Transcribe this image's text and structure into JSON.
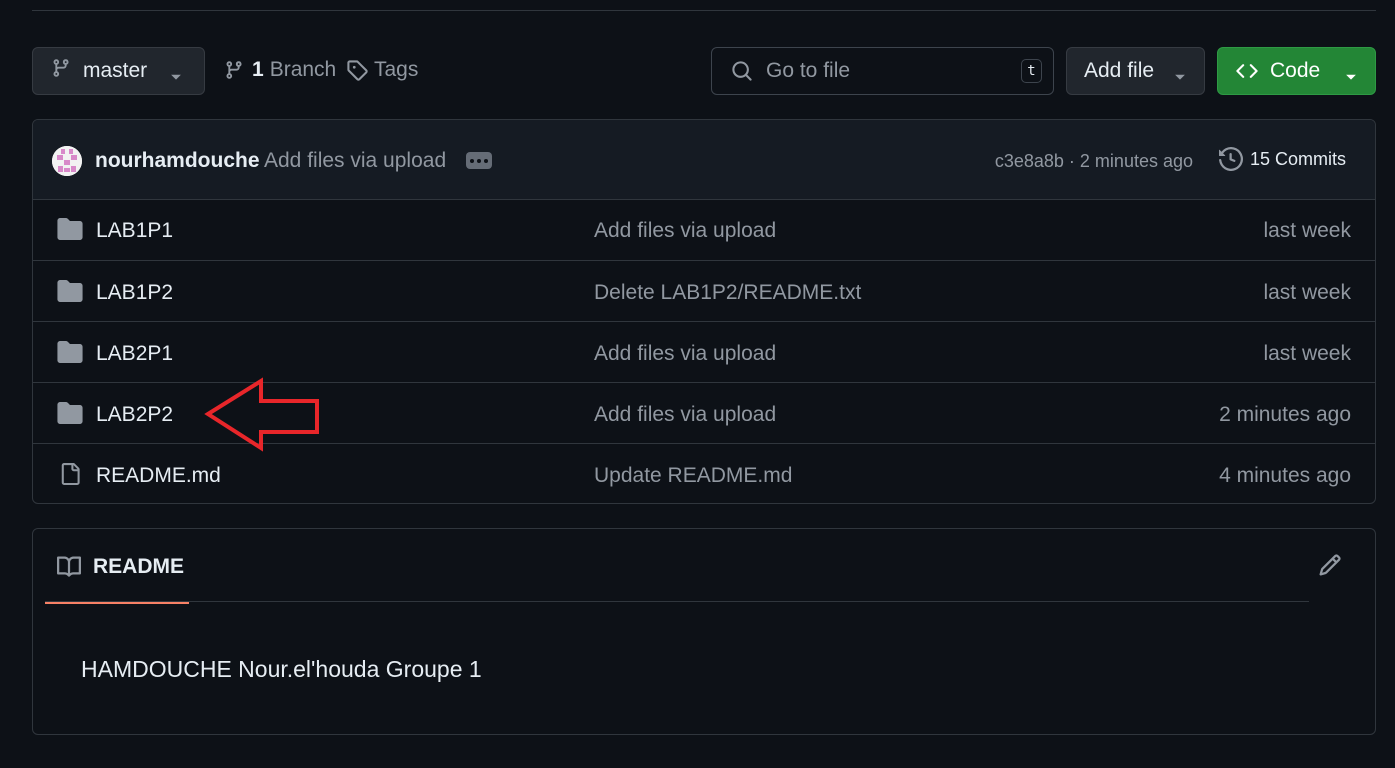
{
  "toolbar": {
    "branch": {
      "name": "master",
      "icon": "git-branch-icon"
    },
    "branch_count": {
      "count": "1",
      "label": "Branch"
    },
    "tags": {
      "label": "Tags"
    },
    "search": {
      "placeholder": "Go to file",
      "shortcut": "t"
    },
    "add_file": {
      "label": "Add file"
    },
    "code": {
      "label": "Code",
      "color": "#238636"
    }
  },
  "latest_commit": {
    "author": "nourhamdouche",
    "message": "Add files via upload",
    "sha": "c3e8a8b",
    "separator": "·",
    "time": "2 minutes ago",
    "commits_label": "15 Commits"
  },
  "files": [
    {
      "type": "folder",
      "name": "LAB1P1",
      "commit": "Add files via upload",
      "time": "last week"
    },
    {
      "type": "folder",
      "name": "LAB1P2",
      "commit": "Delete LAB1P2/README.txt",
      "time": "last week"
    },
    {
      "type": "folder",
      "name": "LAB2P1",
      "commit": "Add files via upload",
      "time": "last week"
    },
    {
      "type": "folder",
      "name": "LAB2P2",
      "commit": "Add files via upload",
      "time": "2 minutes ago"
    },
    {
      "type": "file",
      "name": "README.md",
      "commit": "Update README.md",
      "time": "4 minutes ago"
    }
  ],
  "annotation": {
    "type": "arrow",
    "color": "#e8262a",
    "points_to": "LAB2P2"
  },
  "readme": {
    "tab_label": "README",
    "body": "HAMDOUCHE Nour.el'houda Groupe 1",
    "accent": "#f78166"
  }
}
